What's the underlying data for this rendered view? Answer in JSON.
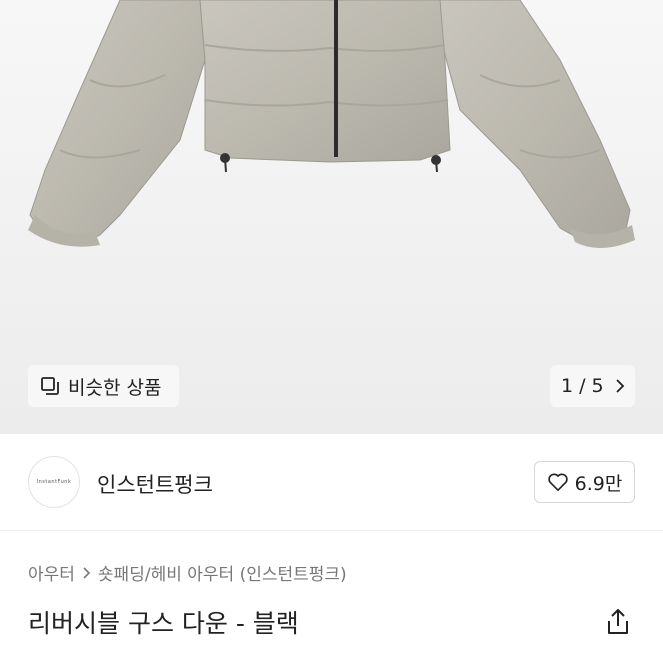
{
  "gallery": {
    "similar_label": "비슷한 상품",
    "pager_current": "1",
    "pager_separator": "/",
    "pager_total": "5"
  },
  "store": {
    "logo_text": "InstantFunk",
    "name": "인스턴트펑크",
    "likes": "6.9만"
  },
  "breadcrumb": {
    "category": "아우터",
    "subcategory": "숏패딩/헤비 아우터 (인스턴트펑크)"
  },
  "product": {
    "title": "리버시블 구스 다운 - 블랙"
  },
  "icons": {
    "similar": "stacked-squares-icon",
    "pager": "chevron-right-icon",
    "like": "heart-icon",
    "breadcrumb": "chevron-right-icon",
    "share": "share-icon"
  }
}
